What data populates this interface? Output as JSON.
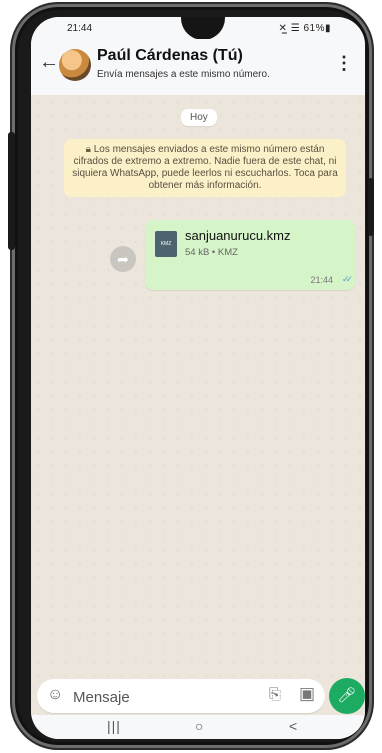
{
  "status_bar": {
    "time": "21:44",
    "icons": "✕̲ ☰▐ 61%▮",
    "battery": "61%"
  },
  "header": {
    "back_icon": "←",
    "name": "Paúl Cárdenas (Tú)",
    "subtitle": "Envía mensajes a este mismo número.",
    "menu_icon": "⋮"
  },
  "chat": {
    "date_chip": "Hoy",
    "notice": "Los mensajes enviados a este mismo número están cifrados de extremo a extremo. Nadie fuera de este chat, ni siquiera WhatsApp, puede leerlos ni escucharlos. Toca para obtener más información.",
    "notice_icon": "lock-icon",
    "message": {
      "file_name": "sanjuanurucu.kmz",
      "file_meta": "54 kB • KMZ",
      "file_icon_text": "KMZ",
      "time": "21:44",
      "status": "read"
    }
  },
  "input": {
    "placeholder": "Mensaje"
  },
  "nav": {
    "recents": "|||",
    "home": "○",
    "back": "<"
  },
  "colors": {
    "bubble": "#d5f4c8",
    "mic": "#1daa61",
    "notice": "#fbf0c8",
    "ticks": "#4aa3e8"
  }
}
